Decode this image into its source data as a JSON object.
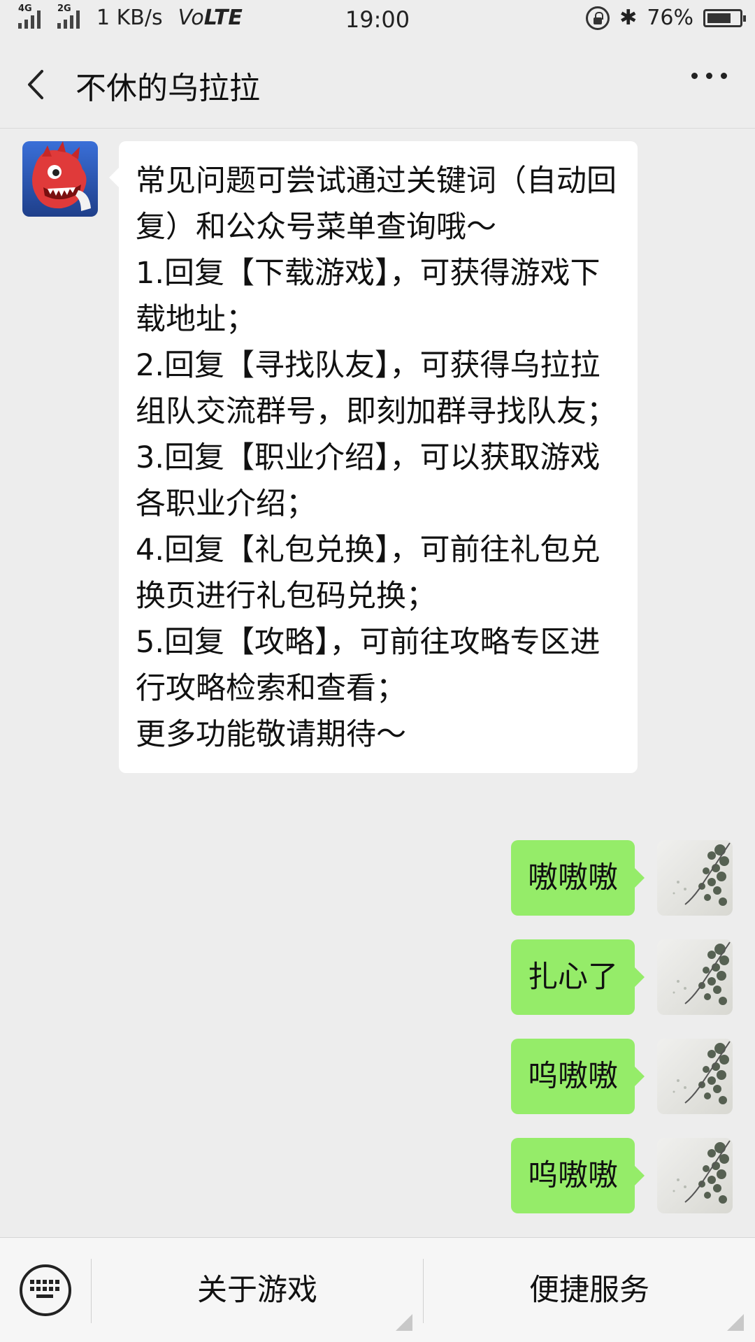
{
  "status_bar": {
    "net_type_1": "4G",
    "net_type_2": "2G",
    "speed": "1 KB/s",
    "volte_vo": "Vo",
    "volte_lte": "LTE",
    "time": "19:00",
    "bluetooth": "✱",
    "battery_percent": "76%",
    "battery_level": 0.76
  },
  "header": {
    "title": "不休的乌拉拉"
  },
  "messages": {
    "bot_lines": [
      "常见问题可尝试通过关键词（自动回复）和公众号菜单查询哦～",
      "1.回复【下载游戏】，可获得游戏下载地址；",
      "2.回复【寻找队友】，可获得乌拉拉组队交流群号，即刻加群寻找队友；",
      "3.回复【职业介绍】，可以获取游戏各职业介绍；",
      "4.回复【礼包兑换】，可前往礼包兑换页进行礼包码兑换；",
      "5.回复【攻略】，可前往攻略专区进行攻略检索和查看；",
      "更多功能敬请期待～"
    ],
    "user": [
      "嗷嗷嗷",
      "扎心了",
      "呜嗷嗷",
      "呜嗷嗷"
    ]
  },
  "menu": {
    "items": [
      "关于游戏",
      "便捷服务"
    ]
  },
  "colors": {
    "user_bubble": "#95ec69",
    "bot_bubble": "#ffffff",
    "background": "#ededed"
  }
}
